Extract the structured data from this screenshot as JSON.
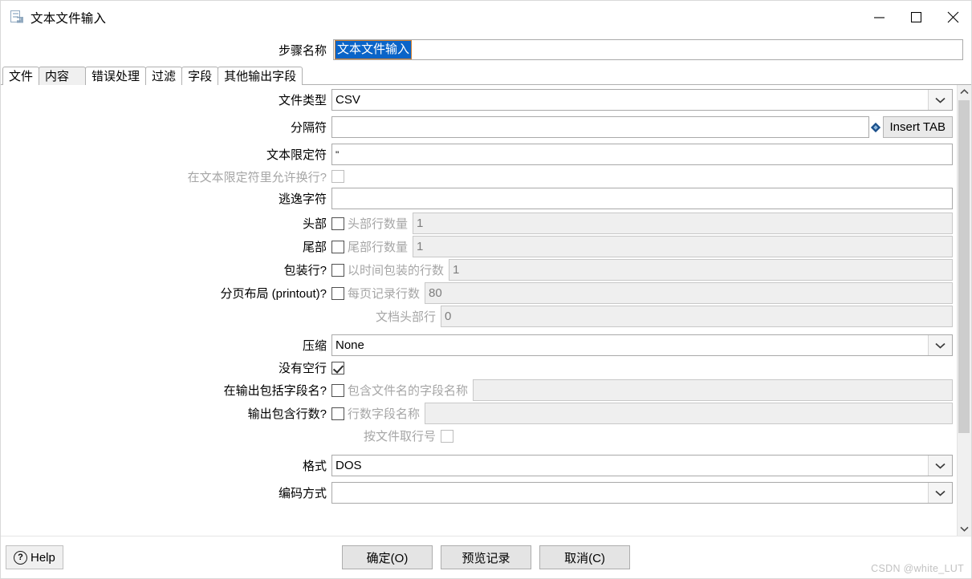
{
  "window": {
    "title": "文本文件输入",
    "icon": "text-file-input-icon",
    "minimize_label": "—",
    "maximize_label": "□",
    "close_label": "✕"
  },
  "step": {
    "label": "步骤名称",
    "value": "文本文件输入",
    "placeholder": ""
  },
  "tabs": [
    {
      "label": "文件",
      "active": false
    },
    {
      "label": "内容",
      "active": true
    },
    {
      "label": "错误处理",
      "active": false
    },
    {
      "label": "过滤",
      "active": false
    },
    {
      "label": "字段",
      "active": false
    },
    {
      "label": "其他输出字段",
      "active": false
    }
  ],
  "form": {
    "filetype": {
      "label": "文件类型",
      "value": "CSV"
    },
    "separator": {
      "label": "分隔符",
      "value": "",
      "insert_tab": "Insert TAB",
      "var_icon": "variable-diamond-icon"
    },
    "enclosure": {
      "label": "文本限定符",
      "value": "\""
    },
    "allow_breaks": {
      "label": "在文本限定符里允许换行?",
      "checked": false
    },
    "escape": {
      "label": "逃逸字符",
      "value": ""
    },
    "header": {
      "label": "头部",
      "checked": false,
      "sub_label": "头部行数量",
      "value": "1"
    },
    "footer": {
      "label": "尾部",
      "checked": false,
      "sub_label": "尾部行数量",
      "value": "1"
    },
    "wrapped": {
      "label": "包装行?",
      "checked": false,
      "sub_label": "以时间包装的行数",
      "value": "1"
    },
    "paged": {
      "label": "分页布局 (printout)?",
      "checked": false,
      "sub_label": "每页记录行数",
      "value": "80"
    },
    "doc_header": {
      "label": "文档头部行",
      "value": "0"
    },
    "compression": {
      "label": "压缩",
      "value": "None"
    },
    "no_empty_rows": {
      "label": "没有空行",
      "checked": true
    },
    "include_filename": {
      "label": "在输出包括字段名?",
      "checked": false,
      "sub_label": "包含文件名的字段名称",
      "value": ""
    },
    "include_rownum": {
      "label": "输出包含行数?",
      "checked": false,
      "sub_label": "行数字段名称",
      "value": ""
    },
    "rownum_by_file": {
      "label": "按文件取行号",
      "checked": false
    },
    "format": {
      "label": "格式",
      "value": "DOS"
    },
    "encoding": {
      "label": "编码方式",
      "value": ""
    }
  },
  "footer": {
    "help": "Help",
    "ok": "确定(O)",
    "preview": "预览记录",
    "cancel": "取消(C)",
    "watermark": "CSDN @white_LUT"
  }
}
